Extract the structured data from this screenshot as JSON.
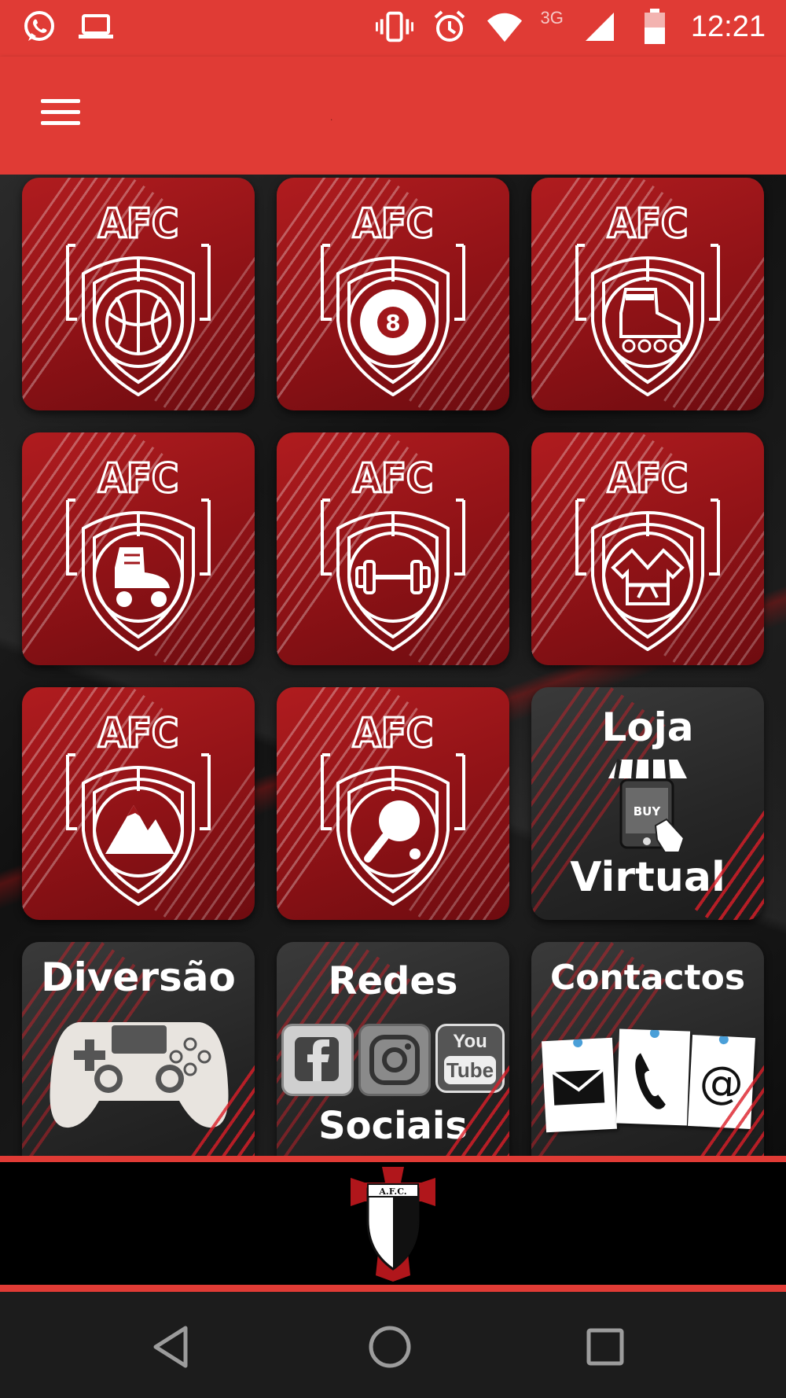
{
  "status_bar": {
    "network": "3G",
    "time": "12:21"
  },
  "app_bar": {
    "title": "."
  },
  "tiles": {
    "loja_line1": "Loja",
    "loja_line2": "Virtual",
    "buy_label": "BUY",
    "diversao": "Diversão",
    "redes_line1": "Redes",
    "redes_line2": "Sociais",
    "contactos": "Contactos",
    "youtube_you": "You",
    "youtube_tube": "Tube",
    "crest_text": "AFC"
  },
  "footer": {
    "logo_text": "A.F.C."
  },
  "colors": {
    "brand_red": "#e03b35",
    "tile_red": "#a0171b",
    "tile_dark": "#2c2c2c"
  },
  "icons": [
    "whatsapp-icon",
    "laptop-icon",
    "vibrate-icon",
    "alarm-icon",
    "wifi-icon",
    "signal-icon",
    "battery-icon",
    "menu-icon",
    "basketball-icon",
    "billiard-8-ball-icon",
    "inline-skate-icon",
    "roller-skate-icon",
    "dumbbell-icon",
    "kimono-icon",
    "mountain-icon",
    "ping-pong-icon",
    "shop-icon",
    "gamepad-icon",
    "facebook-icon",
    "instagram-icon",
    "youtube-icon",
    "mail-icon",
    "phone-icon",
    "at-icon",
    "back-icon",
    "home-icon",
    "recents-icon"
  ]
}
